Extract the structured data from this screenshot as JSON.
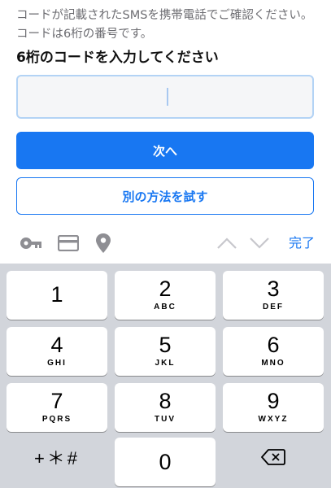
{
  "instruction": "コードが記載されたSMSを携帯電話でご確認ください。コードは6桁の番号です。",
  "heading": "6桁のコードを入力してください",
  "code_input": {
    "value": ""
  },
  "buttons": {
    "next": "次へ",
    "other_method": "別の方法を試す"
  },
  "toolbar": {
    "icons": [
      "key-icon",
      "credit-card-icon",
      "location-pin-icon",
      "chevron-up-icon",
      "chevron-down-icon"
    ],
    "done": "完了"
  },
  "keypad": {
    "keys": [
      {
        "num": "1",
        "letters": ""
      },
      {
        "num": "2",
        "letters": "ABC"
      },
      {
        "num": "3",
        "letters": "DEF"
      },
      {
        "num": "4",
        "letters": "GHI"
      },
      {
        "num": "5",
        "letters": "JKL"
      },
      {
        "num": "6",
        "letters": "MNO"
      },
      {
        "num": "7",
        "letters": "PQRS"
      },
      {
        "num": "8",
        "letters": "TUV"
      },
      {
        "num": "9",
        "letters": "WXYZ"
      },
      {
        "num": "+＊#",
        "letters": ""
      },
      {
        "num": "0",
        "letters": ""
      }
    ],
    "delete_icon": "backspace-icon"
  },
  "colors": {
    "accent": "#1877f2",
    "keyboard_bg": "#d2d5db",
    "input_border": "#b3d3f5"
  }
}
